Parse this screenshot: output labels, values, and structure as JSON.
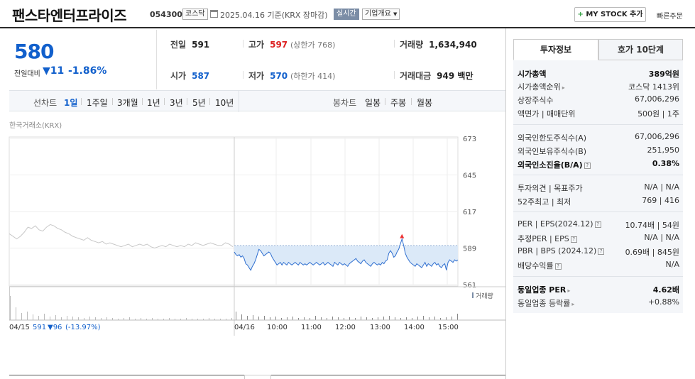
{
  "header": {
    "title": "팬스타엔터프라이즈",
    "code": "054300",
    "market": "코스닥",
    "date_text": "2025.04.16  기준(KRX  장마감)",
    "realtime": "실시간",
    "overview": "기업개요",
    "mystock_plus": "+",
    "mystock": "MY STOCK 추가",
    "quick_order": "빠른주문"
  },
  "price": {
    "now": "580",
    "diff_label": "전일대비",
    "diff": "▼11",
    "rate": "-1.86%"
  },
  "quote": {
    "prev_label": "전일",
    "prev": "591",
    "high_label": "고가",
    "high": "597",
    "upper_limit": "(상한가 768)",
    "volume_label": "거래량",
    "volume": "1,634,940",
    "open_label": "시가",
    "open": "587",
    "low_label": "저가",
    "low": "570",
    "lower_limit": "(하한가 414)",
    "amount_label": "거래대금",
    "amount": "949 백만"
  },
  "period": {
    "label": "선차트",
    "items": [
      "1일",
      "1주일",
      "3개월",
      "1년",
      "3년",
      "5년",
      "10년"
    ],
    "selected": "1일",
    "candle_label": "봉차트",
    "candles": [
      "일봉",
      "주봉",
      "월봉"
    ]
  },
  "chart_header": "한국거래소(KRX)",
  "chart_data": {
    "type": "line",
    "series": [
      {
        "values": [
          600,
          598,
          596,
          598,
          601,
          605,
          604,
          606,
          603,
          602,
          605,
          607,
          606,
          604,
          603,
          601,
          600,
          598,
          597,
          596,
          595,
          597,
          595,
          594,
          593,
          594,
          592,
          593,
          592,
          591,
          590,
          591,
          592,
          590,
          591,
          592,
          591,
          592,
          590,
          589,
          590,
          591,
          590,
          592,
          591,
          590,
          591,
          590,
          592,
          591,
          593,
          592,
          591,
          592,
          593,
          592,
          591,
          591,
          593,
          592,
          590
        ]
      },
      {
        "values": [
          586,
          584,
          583,
          584,
          582,
          583,
          581,
          577,
          576,
          574,
          572,
          575,
          577,
          580,
          584,
          588,
          587,
          585,
          583,
          584,
          585,
          586,
          585,
          582,
          580,
          578,
          576,
          577,
          578,
          576,
          578,
          577,
          576,
          578,
          577,
          576,
          577,
          578,
          577,
          576,
          578,
          577,
          576,
          577,
          576,
          577,
          578,
          577,
          576,
          577,
          578,
          577,
          576,
          577,
          578,
          576,
          577,
          578,
          577,
          576,
          575,
          578,
          577,
          576,
          578,
          577,
          576,
          577,
          576,
          575,
          577,
          578,
          579,
          580,
          581,
          579,
          578,
          577,
          579,
          580,
          578,
          577,
          576,
          575,
          577,
          578,
          577,
          576,
          577,
          576,
          578,
          577,
          579,
          580,
          585,
          587,
          585,
          582,
          583,
          586,
          588,
          592,
          596,
          591,
          585,
          582,
          580,
          578,
          577,
          576,
          575,
          577,
          576,
          575,
          574,
          576,
          578,
          575,
          577,
          576,
          575,
          577,
          578,
          576,
          577,
          575,
          574,
          576,
          577,
          572,
          578,
          580,
          579,
          578,
          580,
          579,
          580
        ]
      }
    ],
    "y_ticks": [
      "673",
      "645",
      "617",
      "589",
      "561"
    ],
    "ylim": [
      561,
      673
    ],
    "x_labels": [
      "04/15",
      "04/16",
      "10:00",
      "11:00",
      "12:00",
      "13:00",
      "14:00",
      "15:00"
    ],
    "prev_close": 591,
    "high_marker": 597,
    "volume_legend": "거래량",
    "prev_day_summary": {
      "date": "04/15",
      "close": "591",
      "change": "▼96",
      "rate": "(-13.97%)"
    }
  },
  "info": {
    "tab_info": "투자정보",
    "tab_order": "호가 10단계",
    "rows": [
      {
        "k": "시가총액",
        "v": "389억원",
        "bold": true
      },
      {
        "k": "시가총액순위",
        "v": "코스닥 1413위",
        "arrow": true
      },
      {
        "k": "상장주식수",
        "v": "67,006,296"
      },
      {
        "k": "액면가 | 매매단위",
        "v": "500원 | 1주"
      },
      {
        "k": "외국인한도주식수(A)",
        "v": "67,006,296"
      },
      {
        "k": "외국인보유주식수(B)",
        "v": "251,950"
      },
      {
        "k": "외국인소진율(B/A)",
        "v": "0.38%",
        "bold": true,
        "q": true
      },
      {
        "k": "투자의견 | 목표주가",
        "v": "N/A | N/A"
      },
      {
        "k": "52주최고 | 최저",
        "v": "769 | 416"
      },
      {
        "k": "PER | EPS(2024.12)",
        "v": "10.74배 | 54원",
        "q": true
      },
      {
        "k": "추정PER | EPS",
        "v": "N/A | N/A",
        "q": true
      },
      {
        "k": "PBR | BPS (2024.12)",
        "v": "0.69배 | 845원",
        "q": true
      },
      {
        "k": "배당수익률",
        "v": "N/A",
        "q": true
      },
      {
        "k": "동일업종 PER",
        "v": "4.62배",
        "bold": true,
        "arrow": true
      },
      {
        "k": "동일업종 등락률",
        "v": "+0.88%",
        "arrow": true,
        "red": true
      }
    ]
  }
}
